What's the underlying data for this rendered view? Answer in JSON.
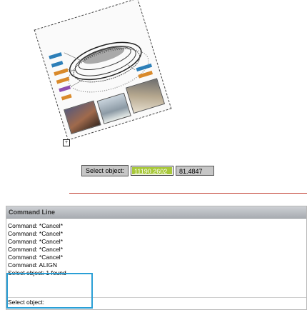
{
  "dynamic_input": {
    "prompt": "Select object:",
    "x_value": "11190.2602",
    "y_value": "81.4847"
  },
  "command_line": {
    "title": "Command Line",
    "history": [
      "Command: *Cancel*",
      "Command: *Cancel*",
      "Command: *Cancel*",
      "Command: *Cancel*",
      "Command: *Cancel*",
      "Command: ALIGN",
      "Select object: 1 found"
    ],
    "current_prompt": "Select object:"
  },
  "colors": {
    "highlight": "#2a9fd6",
    "active_field": "#a8c83a",
    "divider_line": "#c0392b"
  }
}
